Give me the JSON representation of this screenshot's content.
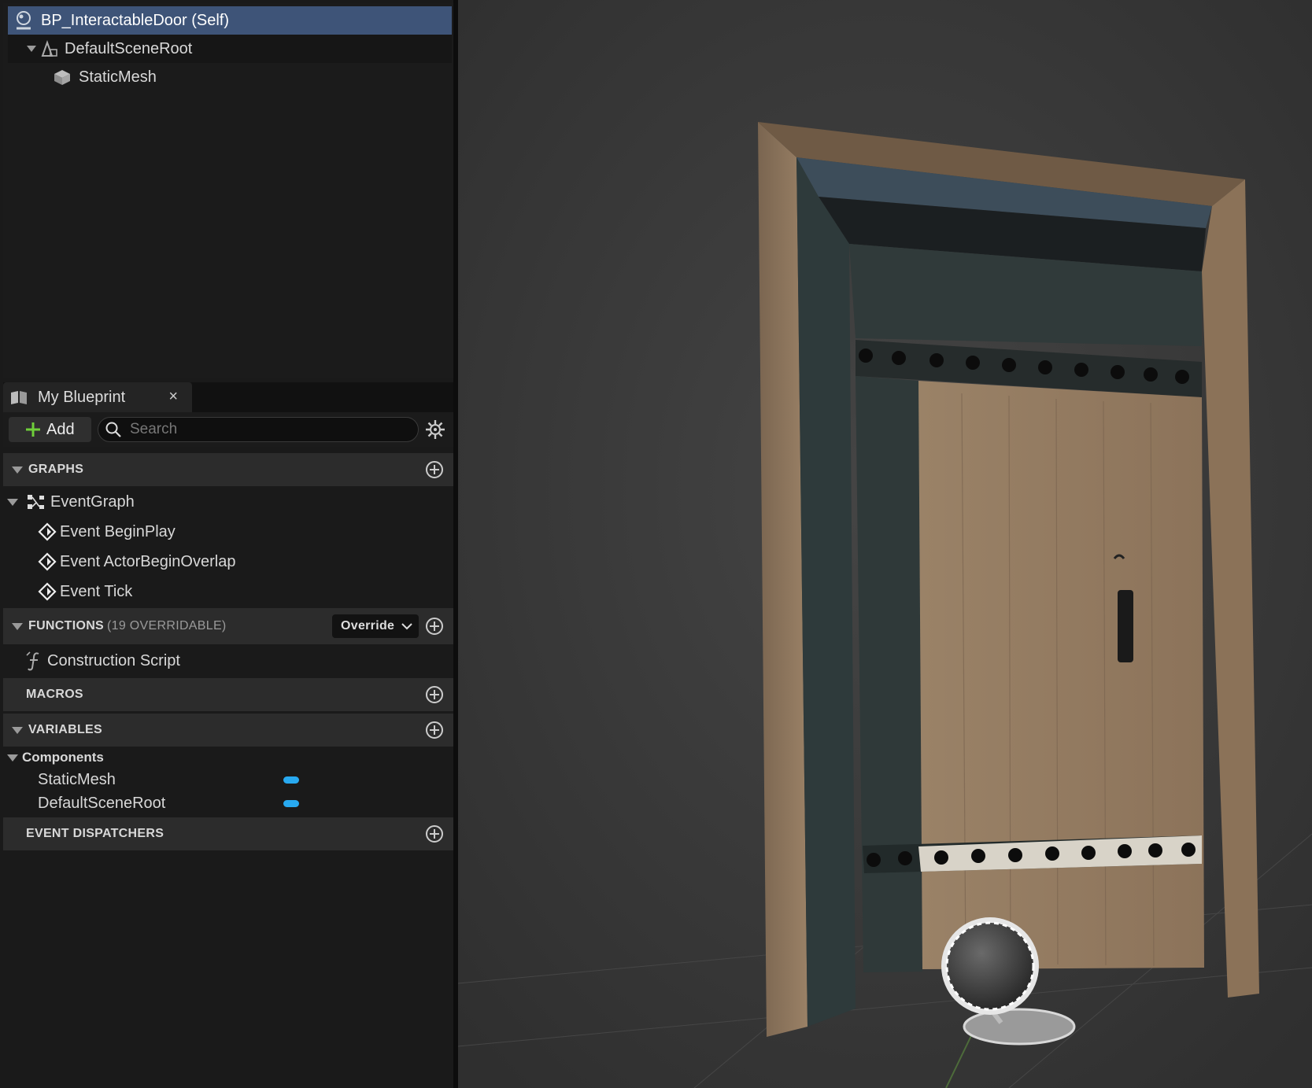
{
  "components": {
    "self_label": "BP_InteractableDoor (Self)",
    "root_label": "DefaultSceneRoot",
    "mesh_label": "StaticMesh"
  },
  "my_blueprint": {
    "tab_label": "My Blueprint",
    "close_glyph": "×",
    "add_label": "Add",
    "search_placeholder": "Search",
    "graphs": {
      "header": "GRAPHS",
      "event_graph": "EventGraph",
      "events": [
        "Event BeginPlay",
        "Event ActorBeginOverlap",
        "Event Tick"
      ]
    },
    "functions": {
      "header": "FUNCTIONS",
      "overridable": "(19 OVERRIDABLE)",
      "override_label": "Override",
      "construction_script": "Construction Script"
    },
    "macros": {
      "header": "MACROS"
    },
    "variables": {
      "header": "VARIABLES",
      "category": "Components",
      "items": [
        "StaticMesh",
        "DefaultSceneRoot"
      ]
    },
    "event_dispatchers": {
      "header": "EVENT DISPATCHERS"
    }
  },
  "colors": {
    "selection": "#3e5478",
    "accent_green": "#6fcf3a",
    "variable_pill": "#28a9f0",
    "viewport_bg": "#3b3b3b"
  },
  "icons": {
    "self": "actor-globe-icon",
    "root": "scene-root-icon",
    "mesh": "static-mesh-cube-icon",
    "graph": "event-graph-icon",
    "event": "event-diamond-icon",
    "function": "function-icon",
    "add_section": "plus-circle-icon",
    "settings": "gear-icon",
    "search": "search-icon"
  }
}
